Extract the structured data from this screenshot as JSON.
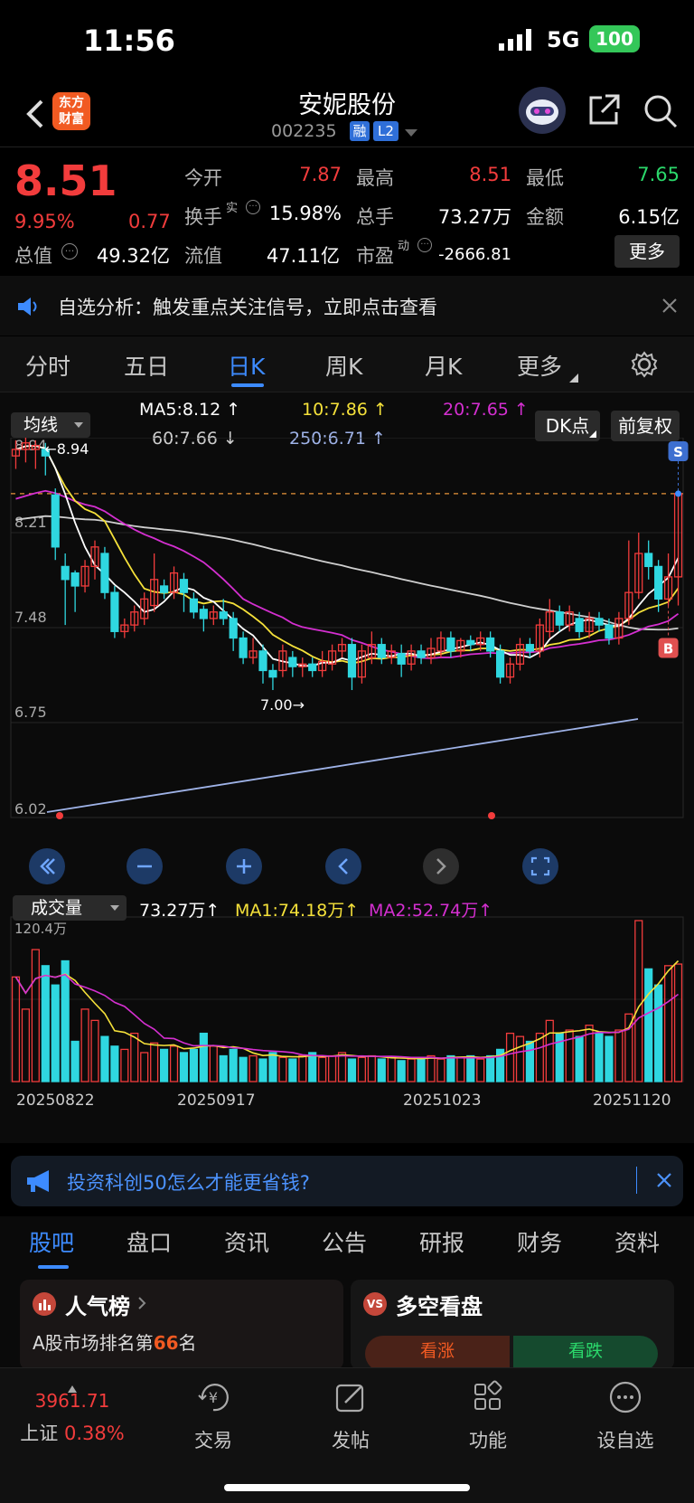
{
  "status": {
    "time": "11:56",
    "network": "5G",
    "battery": "100"
  },
  "header": {
    "title": "安妮股份",
    "code": "002235",
    "badge_rong": "融",
    "badge_l2": "L2",
    "logo_line1": "东方",
    "logo_line2": "财富"
  },
  "quote": {
    "price": "8.51",
    "pct": "9.95%",
    "change": "0.77",
    "open_label": "今开",
    "open": "7.87",
    "high_label": "最高",
    "high": "8.51",
    "low_label": "最低",
    "low": "7.65",
    "turnover_label": "换手",
    "turnover_sup": "实",
    "turnover": "15.98%",
    "volume_label": "总手",
    "volume": "73.27万",
    "amount_label": "金额",
    "amount": "6.15亿",
    "mcap_label": "总值",
    "mcap": "49.32亿",
    "float_label": "流值",
    "float": "47.11亿",
    "pe_label": "市盈",
    "pe_sup": "动",
    "pe": "-2666.81",
    "more": "更多"
  },
  "notice": {
    "text": "自选分析：触发重点关注信号，立即点击查看"
  },
  "chart_tabs": [
    "分时",
    "五日",
    "日K",
    "周K",
    "月K",
    "更多"
  ],
  "active_tab": "日K",
  "ma_legend": {
    "selector": "均线",
    "ma5": "MA5:8.12",
    "ma10": "10:7.86",
    "ma20": "20:7.65",
    "ma60": "60:7.66",
    "ma250": "250:6.71",
    "dk": "DK点",
    "fq": "前复权"
  },
  "price_axis": [
    "8.94",
    "8.21",
    "7.48",
    "6.75",
    "6.02"
  ],
  "annotations": {
    "high": "8.94",
    "low": "7.00",
    "s": "S",
    "b": "B"
  },
  "volume_legend": {
    "selector": "成交量",
    "vol": "73.27万",
    "ma1": "MA1:74.18万",
    "ma2": "MA2:52.74万",
    "axis_max": "120.4万"
  },
  "dates": [
    "20250822",
    "20250917",
    "20251023",
    "20251120"
  ],
  "colors": {
    "up": "#f23c3c",
    "down": "#2fd7e0",
    "ma5": "#ffffff",
    "ma10": "#f5e13a",
    "ma20": "#d42fd0",
    "ma60": "#cfcfcf",
    "ma250": "#9fb3e8",
    "accent": "#3d8bff"
  },
  "ad": {
    "text": "投资科创50怎么才能更省钱?"
  },
  "bottom_tabs": [
    "股吧",
    "盘口",
    "资讯",
    "公告",
    "研报",
    "财务",
    "资料"
  ],
  "cards": {
    "left_title": "人气榜",
    "left_sub1": "A股市场排名第",
    "left_rank": "66",
    "left_sub2": "名",
    "right_title": "多空看盘",
    "bull": "看涨",
    "bear": "看跌"
  },
  "nav": {
    "index_value": "3961.71",
    "index_name": "上证",
    "index_pct": "0.38%",
    "trade": "交易",
    "post": "发帖",
    "func": "功能",
    "watch": "设自选"
  },
  "chart_data": {
    "type": "candlestick",
    "ylim": [
      6.02,
      8.94
    ],
    "x_labels": [
      "20250822",
      "20250917",
      "20251023",
      "20251120"
    ],
    "candles": [
      [
        8.8,
        8.85,
        8.92,
        8.7
      ],
      [
        8.85,
        8.9,
        8.94,
        8.75
      ],
      [
        8.85,
        8.88,
        8.92,
        8.7
      ],
      [
        8.85,
        8.8,
        8.9,
        8.65
      ],
      [
        8.5,
        8.1,
        8.55,
        8.0
      ],
      [
        7.95,
        7.85,
        8.05,
        7.5
      ],
      [
        7.9,
        7.8,
        7.92,
        7.6
      ],
      [
        7.8,
        7.95,
        8.0,
        7.75
      ],
      [
        7.95,
        8.1,
        8.15,
        7.85
      ],
      [
        8.05,
        7.75,
        8.1,
        7.7
      ],
      [
        7.75,
        7.45,
        7.8,
        7.4
      ],
      [
        7.45,
        7.5,
        7.55,
        7.4
      ],
      [
        7.5,
        7.6,
        7.65,
        7.45
      ],
      [
        7.55,
        7.7,
        7.75,
        7.5
      ],
      [
        7.65,
        7.85,
        8.05,
        7.6
      ],
      [
        7.8,
        7.75,
        7.85,
        7.7
      ],
      [
        7.75,
        7.9,
        7.95,
        7.7
      ],
      [
        7.85,
        7.75,
        7.9,
        7.6
      ],
      [
        7.7,
        7.6,
        7.75,
        7.55
      ],
      [
        7.62,
        7.55,
        7.65,
        7.45
      ],
      [
        7.55,
        7.6,
        7.65,
        7.5
      ],
      [
        7.6,
        7.55,
        7.7,
        7.5
      ],
      [
        7.55,
        7.4,
        7.6,
        7.3
      ],
      [
        7.4,
        7.25,
        7.45,
        7.2
      ],
      [
        7.25,
        7.3,
        7.4,
        7.2
      ],
      [
        7.3,
        7.15,
        7.35,
        7.05
      ],
      [
        7.15,
        7.1,
        7.2,
        7.0
      ],
      [
        7.15,
        7.3,
        7.35,
        7.1
      ],
      [
        7.25,
        7.18,
        7.3,
        7.1
      ],
      [
        7.18,
        7.2,
        7.25,
        7.1
      ],
      [
        7.2,
        7.15,
        7.25,
        7.1
      ],
      [
        7.15,
        7.22,
        7.3,
        7.1
      ],
      [
        7.2,
        7.3,
        7.35,
        7.15
      ],
      [
        7.3,
        7.35,
        7.4,
        7.25
      ],
      [
        7.35,
        7.1,
        7.4,
        7.0
      ],
      [
        7.1,
        7.3,
        7.35,
        7.05
      ],
      [
        7.25,
        7.35,
        7.45,
        7.2
      ],
      [
        7.35,
        7.25,
        7.4,
        7.2
      ],
      [
        7.25,
        7.3,
        7.35,
        7.2
      ],
      [
        7.28,
        7.2,
        7.35,
        7.1
      ],
      [
        7.2,
        7.3,
        7.35,
        7.15
      ],
      [
        7.3,
        7.25,
        7.35,
        7.2
      ],
      [
        7.25,
        7.32,
        7.4,
        7.2
      ],
      [
        7.3,
        7.4,
        7.45,
        7.25
      ],
      [
        7.4,
        7.3,
        7.45,
        7.25
      ],
      [
        7.3,
        7.38,
        7.4,
        7.25
      ],
      [
        7.38,
        7.35,
        7.42,
        7.3
      ],
      [
        7.35,
        7.4,
        7.45,
        7.3
      ],
      [
        7.4,
        7.3,
        7.45,
        7.25
      ],
      [
        7.3,
        7.1,
        7.35,
        7.05
      ],
      [
        7.1,
        7.2,
        7.25,
        7.05
      ],
      [
        7.2,
        7.35,
        7.4,
        7.15
      ],
      [
        7.35,
        7.3,
        7.4,
        7.25
      ],
      [
        7.3,
        7.5,
        7.55,
        7.25
      ],
      [
        7.45,
        7.6,
        7.7,
        7.4
      ],
      [
        7.6,
        7.5,
        7.65,
        7.45
      ],
      [
        7.5,
        7.6,
        7.65,
        7.45
      ],
      [
        7.55,
        7.45,
        7.6,
        7.4
      ],
      [
        7.45,
        7.55,
        7.6,
        7.4
      ],
      [
        7.55,
        7.5,
        7.6,
        7.45
      ],
      [
        7.5,
        7.4,
        7.55,
        7.35
      ],
      [
        7.4,
        7.55,
        7.6,
        7.35
      ],
      [
        7.55,
        7.75,
        8.15,
        7.5
      ],
      [
        7.75,
        8.05,
        8.21,
        7.7
      ],
      [
        8.05,
        7.95,
        8.15,
        7.85
      ],
      [
        7.95,
        7.7,
        8.0,
        7.6
      ],
      [
        7.7,
        7.87,
        8.05,
        7.65
      ],
      [
        7.87,
        8.51,
        8.51,
        7.65
      ]
    ],
    "volumes": [
      0.65,
      0.45,
      0.82,
      0.72,
      0.6,
      0.75,
      0.25,
      0.45,
      0.38,
      0.28,
      0.22,
      0.2,
      0.3,
      0.18,
      0.24,
      0.2,
      0.22,
      0.18,
      0.2,
      0.3,
      0.22,
      0.16,
      0.2,
      0.15,
      0.16,
      0.14,
      0.18,
      0.15,
      0.14,
      0.16,
      0.18,
      0.15,
      0.16,
      0.18,
      0.14,
      0.15,
      0.16,
      0.14,
      0.15,
      0.13,
      0.14,
      0.15,
      0.16,
      0.14,
      0.16,
      0.15,
      0.16,
      0.14,
      0.16,
      0.2,
      0.3,
      0.28,
      0.25,
      0.3,
      0.38,
      0.3,
      0.32,
      0.28,
      0.35,
      0.3,
      0.28,
      0.32,
      0.42,
      1.0,
      0.7,
      0.6,
      0.72,
      0.73
    ]
  }
}
